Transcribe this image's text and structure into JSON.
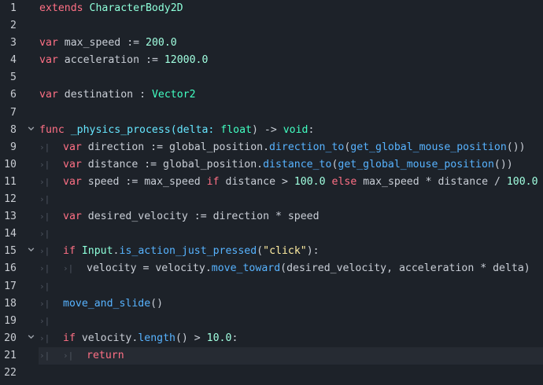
{
  "line_numbers": [
    "1",
    "2",
    "3",
    "4",
    "5",
    "6",
    "7",
    "8",
    "9",
    "10",
    "11",
    "12",
    "13",
    "14",
    "15",
    "16",
    "17",
    "18",
    "19",
    "20",
    "21",
    "22"
  ],
  "tab_marker": "›|",
  "fold_icon": "chevron-down-icon",
  "colors": {
    "background": "#1d2229",
    "current_line": "#262b33",
    "keyword": "#ff7085",
    "class": "#8effda",
    "number": "#a1ffe0",
    "method": "#57b3ff",
    "type": "#42ffc2",
    "string": "#ffeda1"
  },
  "code": {
    "l1": {
      "kw": "extends",
      "cls": "CharacterBody2D"
    },
    "l3": {
      "kw": "var",
      "name": "max_speed",
      "op": ":=",
      "num": "200.0"
    },
    "l4": {
      "kw": "var",
      "name": "acceleration",
      "op": ":=",
      "num": "12000.0"
    },
    "l6": {
      "kw": "var",
      "name": "destination",
      "op": ":",
      "type": "Vector2"
    },
    "l8": {
      "kw": "func",
      "name": "_physics_process(delta:",
      "type": "float",
      "rest": ") ->",
      "ret": "void",
      "colon": ":"
    },
    "l9": {
      "kw": "var",
      "name": "direction := global_position.",
      "fn": "direction_to",
      "paren": "(",
      "fn2": "get_global_mouse_position",
      "end": "())"
    },
    "l10": {
      "kw": "var",
      "name": "distance := global_position.",
      "fn": "distance_to",
      "paren": "(",
      "fn2": "get_global_mouse_position",
      "end": "())"
    },
    "l11": {
      "kw": "var",
      "a": "speed := max_speed",
      "kw_if": "if",
      "b": "distance >",
      "n1": "100.0",
      "kw_else": "else",
      "c": "max_speed * distance /",
      "n2": "100.0"
    },
    "l13": {
      "kw": "var",
      "rest": "desired_velocity := direction * speed"
    },
    "l15": {
      "kw": "if",
      "cls": "Input",
      "dot": ".",
      "fn": "is_action_just_pressed",
      "open": "(",
      "str": "\"click\"",
      "close": "):"
    },
    "l16": {
      "a": "velocity = velocity.",
      "fn": "move_toward",
      "b": "(desired_velocity, acceleration * delta)"
    },
    "l18": {
      "fn": "move_and_slide",
      "end": "()"
    },
    "l20": {
      "kw": "if",
      "a": "velocity.",
      "fn": "length",
      "b": "() >",
      "num": "10.0",
      "colon": ":"
    },
    "l21": {
      "kw": "return"
    }
  }
}
